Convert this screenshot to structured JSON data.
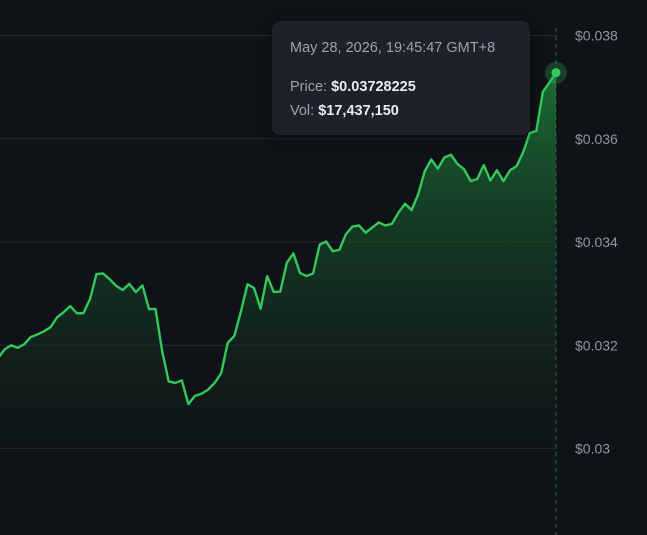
{
  "colors": {
    "background": "#0f1217",
    "line": "#34c759",
    "area_top": "#1e7a3a",
    "grid": "#232830",
    "crosshair": "#2a6b3d",
    "tooltip_bg": "#1c212a"
  },
  "tooltip": {
    "date": "May 28, 2026, 19:45:47 GMT+8",
    "price_label": "Price:",
    "price_value": "$0.03728225",
    "vol_label": "Vol:",
    "vol_value": "$17,437,150"
  },
  "chart_data": {
    "type": "area",
    "title": "",
    "xlabel": "",
    "ylabel": "",
    "ylim": [
      0.029,
      0.03835
    ],
    "yticks": [
      0.03,
      0.032,
      0.034,
      0.036,
      0.038
    ],
    "ytick_labels": [
      "$0.03",
      "$0.032",
      "$0.034",
      "$0.036",
      "$0.038"
    ],
    "grid": true,
    "y_axis_position": "right",
    "series": [
      {
        "values": [
          0.03175,
          0.03192,
          0.032,
          0.03195,
          0.03202,
          0.03216,
          0.03221,
          0.03227,
          0.03235,
          0.03254,
          0.03264,
          0.03276,
          0.03262,
          0.03262,
          0.03289,
          0.03338,
          0.03339,
          0.03328,
          0.03315,
          0.03307,
          0.03319,
          0.03303,
          0.03316,
          0.0327,
          0.0327,
          0.03189,
          0.0313,
          0.03127,
          0.03132,
          0.03086,
          0.03102,
          0.03106,
          0.03114,
          0.03127,
          0.03146,
          0.03205,
          0.03218,
          0.03265,
          0.03318,
          0.03311,
          0.03271,
          0.03334,
          0.03303,
          0.03304,
          0.0336,
          0.03378,
          0.0334,
          0.03334,
          0.03339,
          0.03395,
          0.03401,
          0.03382,
          0.03385,
          0.03415,
          0.0343,
          0.03432,
          0.03418,
          0.03428,
          0.03438,
          0.03432,
          0.03435,
          0.03457,
          0.03474,
          0.03462,
          0.03492,
          0.03537,
          0.0356,
          0.03542,
          0.03564,
          0.03569,
          0.03551,
          0.03541,
          0.03518,
          0.03522,
          0.03549,
          0.03519,
          0.03539,
          0.03518,
          0.03539,
          0.03547,
          0.03574,
          0.03611,
          0.03615,
          0.03691,
          0.03709,
          0.03728
        ]
      }
    ],
    "highlighted_point": {
      "price": 0.03728225,
      "volume": 17437150
    }
  }
}
